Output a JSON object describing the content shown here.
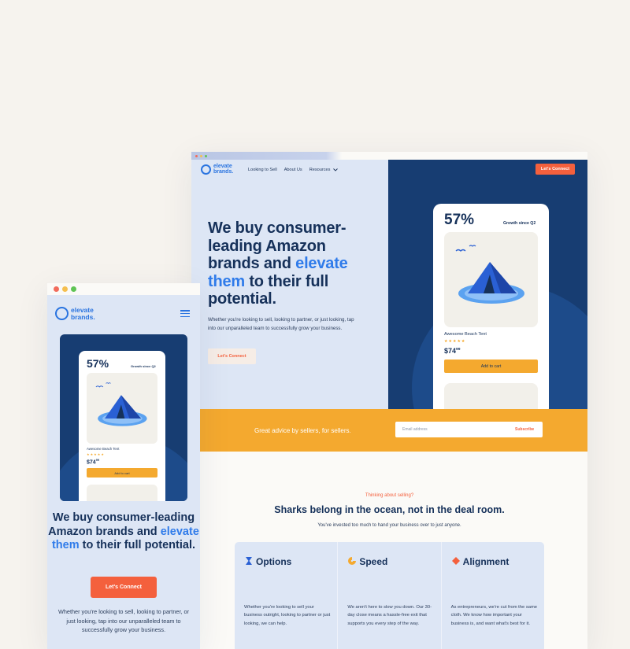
{
  "colors": {
    "navy": "#16315a",
    "hero_blue": "#173d72",
    "accent_blue": "#2f7bea",
    "orange": "#f4603d",
    "yellow": "#f4a92f",
    "light_blue": "#dde6f5",
    "cream": "#f6f3ee"
  },
  "desktop": {
    "logo_line1": "elevate",
    "logo_line2": "brands.",
    "nav": {
      "looking_to_sell": "Looking to Sell",
      "about_us": "About Us",
      "resources": "Resources",
      "resources_icon": "chevron-down-icon"
    },
    "cta_top": "Let's Connect",
    "hero": {
      "headline_part1": "We buy consumer-leading Amazon brands and",
      "headline_highlight": "elevate them",
      "headline_part2": "to their full potential.",
      "subtext": "Whether you're looking to sell, looking to partner, or just looking, tap into our unparalleled team to successfully grow your business.",
      "button": "Let's Connect"
    },
    "phone": {
      "percent": "57%",
      "growth": "Growth since Q2",
      "product_name": "Awesome Beach Tent",
      "stars": "★★★★★",
      "price": "$74",
      "price_cents": "99",
      "add_to_cart": "Add to cart"
    },
    "band": {
      "text": "Great advice by sellers, for sellers.",
      "email_placeholder": "Email address",
      "subscribe": "Subscribe"
    },
    "section": {
      "kicker": "Thinking about selling?",
      "title": "Sharks belong in the ocean, not in the deal room.",
      "subtitle": "You've invested too much to hand your business over to just anyone."
    },
    "features": [
      {
        "title": "Options",
        "icon": "hourglass-icon",
        "description": "Whether you're looking to sell your business outright, looking to partner or just looking, we can help."
      },
      {
        "title": "Speed",
        "icon": "speed-icon",
        "description": "We aren't here to slow you down. Our 30-day close means a hassle-free exit that supports you every step of the way."
      },
      {
        "title": "Alignment",
        "icon": "diamond-icon",
        "description": "As entrepreneurs, we're cut from the same cloth. We know how important your business is, and want what's best for it."
      }
    ]
  },
  "mobile": {
    "logo_line1": "elevate",
    "logo_line2": "brands.",
    "menu_icon": "hamburger-menu-icon",
    "phone": {
      "percent": "57%",
      "growth": "Growth since Q2",
      "product_name": "Awesome Beach Tent",
      "stars": "★★★★★",
      "price": "$74",
      "price_cents": "99",
      "add_to_cart": "Add to cart"
    },
    "headline_part1": "We buy consumer-leading Amazon brands and",
    "headline_highlight": "elevate them",
    "headline_part2": "to their full potential.",
    "button": "Let's Connect",
    "subtext": "Whether you're looking to sell, looking to partner, or just looking, tap into our unparalleled team to successfully grow your business."
  }
}
